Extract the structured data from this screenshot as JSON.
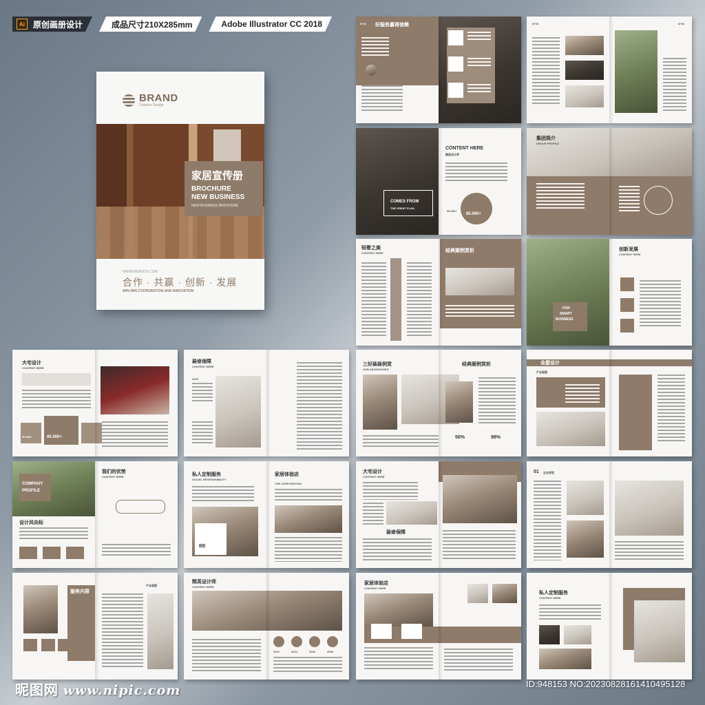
{
  "header": {
    "ai_icon": "Ai",
    "title": "原创画册设计",
    "size_label": "成品尺寸210X285mm",
    "software_label": "Adobe Illustrator CC 2018"
  },
  "cover": {
    "brand": "BRAND",
    "brand_sub": "Creative Design",
    "title_cn": "家居宣传册",
    "title_en_1": "BROCHURE",
    "title_en_2": "NEW BUSINESS",
    "title_en_sub": "NEW BUSINESS BROCHURE",
    "website": "WWW.WEBSITE.COM",
    "slogan_cn": "合作 · 共赢 · 创新 · 发展",
    "slogan_en": "WIN-WIN COOPERATION AND INNOVATION"
  },
  "spreads": [
    {
      "title": "好服务赢得信赖",
      "sub": "N°03"
    },
    {
      "title": "N°05",
      "sub": "N°06"
    },
    {
      "title": "CONTENT HERE",
      "sub": "精英设计师",
      "badge": "COMES FROM",
      "badge2": "THE GREAT PLAN",
      "stat": "85.000+",
      "stat2": "30.000+"
    },
    {
      "title": "集团简介",
      "sub": "GROUP PROFILE"
    },
    {
      "title": "轻奢之美",
      "sub": "CONTENT HERE",
      "title2": "经典案例赏析"
    },
    {
      "title": "创新发展",
      "sub": "CONTENT HERE",
      "badge": "FOR",
      "badge2": "SMART",
      "badge3": "BUSINESS"
    },
    {
      "title": "大宅设计",
      "sub": "CONTENT HERE",
      "stat": "85.000+",
      "stat2": "30.000+"
    },
    {
      "title": "装修保障",
      "sub": "CONTENT HERE",
      "year": "2025"
    },
    {
      "title": "三好装装例赏",
      "sub": "OUR ADVANTAGES",
      "title2": "经典案例赏析",
      "pct1": "56%",
      "pct2": "98%"
    },
    {
      "title": "全屋设计",
      "sub": "产业版图"
    },
    {
      "title": "我们的优势",
      "sub": "CONTENT HERE",
      "title2": "设计风向标",
      "badge": "COMPANY",
      "badge2": "PROFILE"
    },
    {
      "title": "私人定制服务",
      "sub": "SOCIAL RESPONSIBILITY",
      "title2": "家居体验店",
      "sub2": "THE CORPORATION",
      "badge": "BE"
    },
    {
      "title": "大宅设计",
      "sub": "CONTENT HERE",
      "title2": "装修保障"
    },
    {
      "title": "01",
      "sub": "企业宗旨"
    },
    {
      "title": "服务内容",
      "sub": "产业版图"
    },
    {
      "title": "精英设计师",
      "sub": "CONTENT HERE",
      "years": [
        "2022",
        "2024",
        "2026",
        "2028"
      ]
    },
    {
      "title": "家居体验店",
      "sub": "CONTENT HERE"
    },
    {
      "title": "私人定制服务",
      "sub": "CONTENT HERE"
    }
  ],
  "watermark": {
    "site_cn": "昵图网",
    "site_url": "www.nipic.com",
    "id_text": "ID:948153 NO:20230828161410495128"
  }
}
